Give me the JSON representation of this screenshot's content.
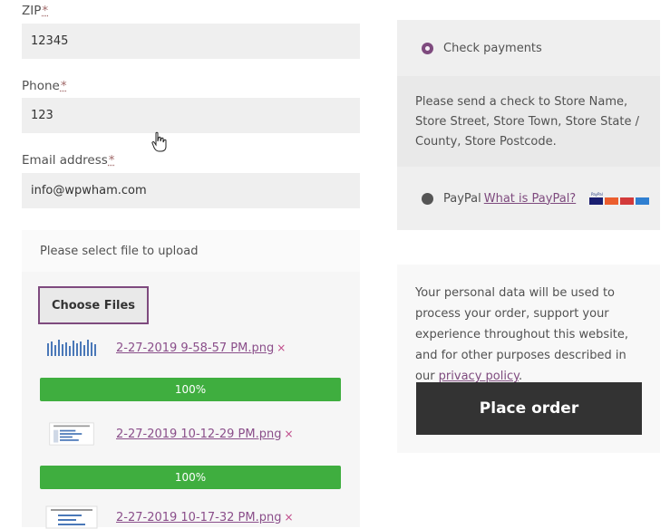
{
  "form": {
    "zip": {
      "label": "ZIP",
      "req_mark": "*",
      "value": "12345"
    },
    "phone": {
      "label": "Phone",
      "req_mark": "*",
      "value": "123"
    },
    "email": {
      "label": "Email address",
      "req_mark": "*",
      "value": "info@wpwham.com"
    }
  },
  "upload": {
    "heading": "Please select file to upload",
    "choose_label": "Choose Files",
    "remove_symbol": "×",
    "files": [
      {
        "name": "2-27-2019 9-58-57 PM.png",
        "progress_label": "100%",
        "progress": 1.0
      },
      {
        "name": "2-27-2019 10-12-29 PM.png",
        "progress_label": "100%",
        "progress": 1.0
      },
      {
        "name": "2-27-2019 10-17-32 PM.png"
      }
    ]
  },
  "payment": {
    "check": {
      "label": "Check payments",
      "selected": true,
      "description": "Please send a check to Store Name, Store Street, Store Town, Store State / County, Store Postcode."
    },
    "paypal": {
      "label": "PayPal",
      "link": "What is PayPal?",
      "selected": false,
      "badge_icon": "paypal-cards-icon"
    }
  },
  "privacy": {
    "text_before": "Your personal data will be used to process your order, support your experience throughout this website, and for other purposes described in our ",
    "link": "privacy policy",
    "text_after": "."
  },
  "place_order_label": "Place order",
  "colors": {
    "accent": "#7e4a7e",
    "progress": "#3fae3f",
    "button_dark": "#333333"
  }
}
